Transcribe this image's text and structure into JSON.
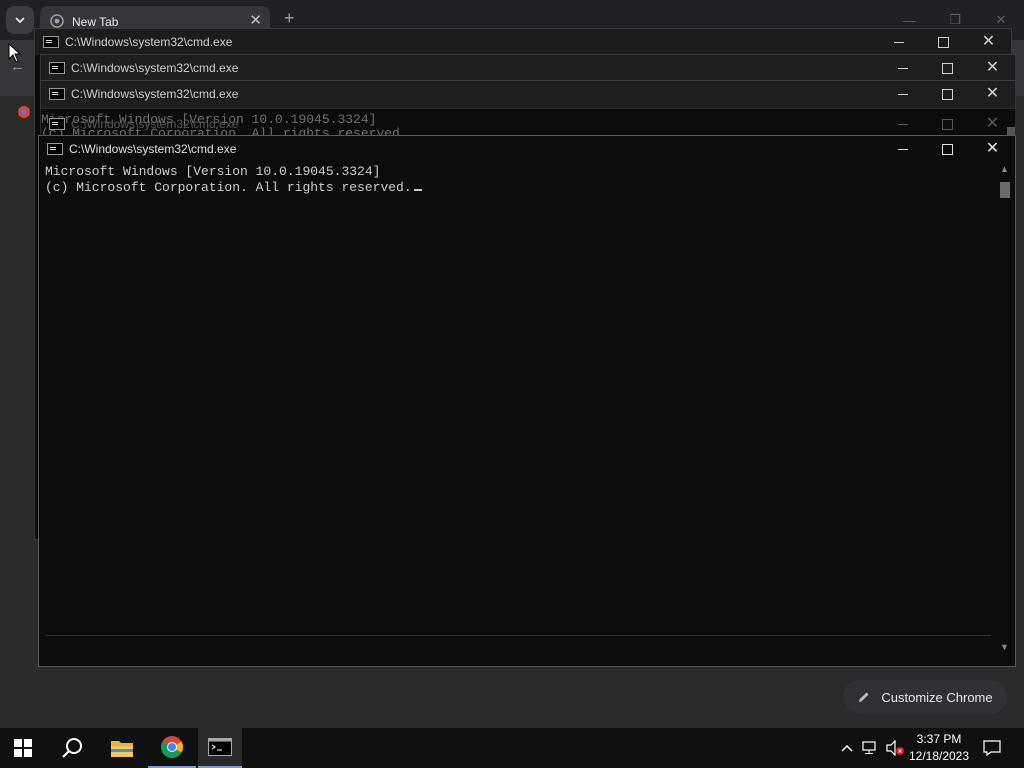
{
  "browser": {
    "tab_title": "New Tab",
    "customize_label": "Customize Chrome"
  },
  "cmd_windows": [
    {
      "title": "C:\\Windows\\system32\\cmd.exe"
    },
    {
      "title": "C:\\Windows\\system32\\cmd.exe"
    },
    {
      "title": "C:\\Windows\\system32\\cmd.exe"
    },
    {
      "title": "C:\\Windows\\system32\\cmd.exe"
    },
    {
      "title": "C:\\Windows\\system32\\cmd.exe"
    }
  ],
  "console": {
    "line1": "Microsoft Windows [Version 10.0.19045.3324]",
    "line2": "(c) Microsoft Corporation. All rights reserved."
  },
  "taskbar": {
    "time": "3:37 PM",
    "date": "12/18/2023"
  },
  "colors": {
    "console_bg": "#0c0c0c",
    "console_text": "#cccccc",
    "taskbar_bg": "#101010",
    "accent": "#7d9bd1"
  }
}
